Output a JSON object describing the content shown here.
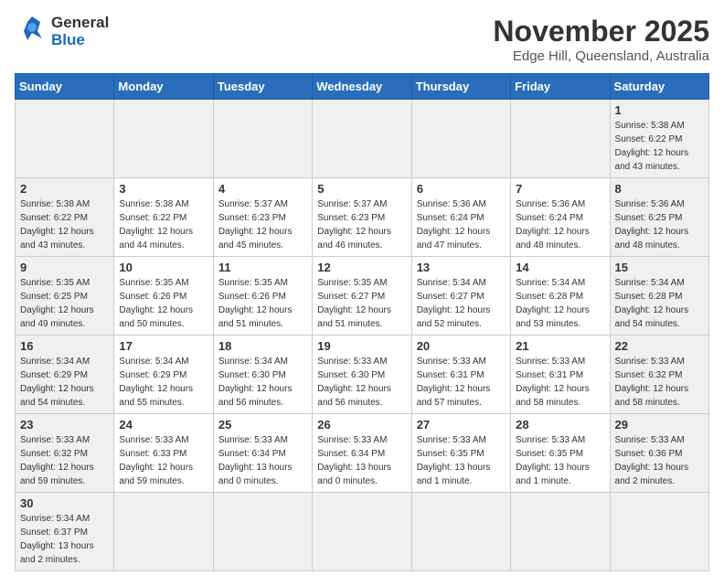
{
  "header": {
    "logo_general": "General",
    "logo_blue": "Blue",
    "month_title": "November 2025",
    "location": "Edge Hill, Queensland, Australia"
  },
  "weekdays": [
    "Sunday",
    "Monday",
    "Tuesday",
    "Wednesday",
    "Thursday",
    "Friday",
    "Saturday"
  ],
  "weeks": [
    [
      {
        "day": "",
        "info": "",
        "empty": true
      },
      {
        "day": "",
        "info": "",
        "empty": true
      },
      {
        "day": "",
        "info": "",
        "empty": true
      },
      {
        "day": "",
        "info": "",
        "empty": true
      },
      {
        "day": "",
        "info": "",
        "empty": true
      },
      {
        "day": "",
        "info": "",
        "empty": true
      },
      {
        "day": "1",
        "info": "Sunrise: 5:38 AM\nSunset: 6:22 PM\nDaylight: 12 hours\nand 43 minutes."
      }
    ],
    [
      {
        "day": "2",
        "info": "Sunrise: 5:38 AM\nSunset: 6:22 PM\nDaylight: 12 hours\nand 43 minutes."
      },
      {
        "day": "3",
        "info": "Sunrise: 5:38 AM\nSunset: 6:22 PM\nDaylight: 12 hours\nand 44 minutes."
      },
      {
        "day": "4",
        "info": "Sunrise: 5:37 AM\nSunset: 6:23 PM\nDaylight: 12 hours\nand 45 minutes."
      },
      {
        "day": "5",
        "info": "Sunrise: 5:37 AM\nSunset: 6:23 PM\nDaylight: 12 hours\nand 46 minutes."
      },
      {
        "day": "6",
        "info": "Sunrise: 5:36 AM\nSunset: 6:24 PM\nDaylight: 12 hours\nand 47 minutes."
      },
      {
        "day": "7",
        "info": "Sunrise: 5:36 AM\nSunset: 6:24 PM\nDaylight: 12 hours\nand 48 minutes."
      },
      {
        "day": "8",
        "info": "Sunrise: 5:36 AM\nSunset: 6:25 PM\nDaylight: 12 hours\nand 48 minutes."
      }
    ],
    [
      {
        "day": "9",
        "info": "Sunrise: 5:35 AM\nSunset: 6:25 PM\nDaylight: 12 hours\nand 49 minutes."
      },
      {
        "day": "10",
        "info": "Sunrise: 5:35 AM\nSunset: 6:26 PM\nDaylight: 12 hours\nand 50 minutes."
      },
      {
        "day": "11",
        "info": "Sunrise: 5:35 AM\nSunset: 6:26 PM\nDaylight: 12 hours\nand 51 minutes."
      },
      {
        "day": "12",
        "info": "Sunrise: 5:35 AM\nSunset: 6:27 PM\nDaylight: 12 hours\nand 51 minutes."
      },
      {
        "day": "13",
        "info": "Sunrise: 5:34 AM\nSunset: 6:27 PM\nDaylight: 12 hours\nand 52 minutes."
      },
      {
        "day": "14",
        "info": "Sunrise: 5:34 AM\nSunset: 6:28 PM\nDaylight: 12 hours\nand 53 minutes."
      },
      {
        "day": "15",
        "info": "Sunrise: 5:34 AM\nSunset: 6:28 PM\nDaylight: 12 hours\nand 54 minutes."
      }
    ],
    [
      {
        "day": "16",
        "info": "Sunrise: 5:34 AM\nSunset: 6:29 PM\nDaylight: 12 hours\nand 54 minutes."
      },
      {
        "day": "17",
        "info": "Sunrise: 5:34 AM\nSunset: 6:29 PM\nDaylight: 12 hours\nand 55 minutes."
      },
      {
        "day": "18",
        "info": "Sunrise: 5:34 AM\nSunset: 6:30 PM\nDaylight: 12 hours\nand 56 minutes."
      },
      {
        "day": "19",
        "info": "Sunrise: 5:33 AM\nSunset: 6:30 PM\nDaylight: 12 hours\nand 56 minutes."
      },
      {
        "day": "20",
        "info": "Sunrise: 5:33 AM\nSunset: 6:31 PM\nDaylight: 12 hours\nand 57 minutes."
      },
      {
        "day": "21",
        "info": "Sunrise: 5:33 AM\nSunset: 6:31 PM\nDaylight: 12 hours\nand 58 minutes."
      },
      {
        "day": "22",
        "info": "Sunrise: 5:33 AM\nSunset: 6:32 PM\nDaylight: 12 hours\nand 58 minutes."
      }
    ],
    [
      {
        "day": "23",
        "info": "Sunrise: 5:33 AM\nSunset: 6:32 PM\nDaylight: 12 hours\nand 59 minutes."
      },
      {
        "day": "24",
        "info": "Sunrise: 5:33 AM\nSunset: 6:33 PM\nDaylight: 12 hours\nand 59 minutes."
      },
      {
        "day": "25",
        "info": "Sunrise: 5:33 AM\nSunset: 6:34 PM\nDaylight: 13 hours\nand 0 minutes."
      },
      {
        "day": "26",
        "info": "Sunrise: 5:33 AM\nSunset: 6:34 PM\nDaylight: 13 hours\nand 0 minutes."
      },
      {
        "day": "27",
        "info": "Sunrise: 5:33 AM\nSunset: 6:35 PM\nDaylight: 13 hours\nand 1 minute."
      },
      {
        "day": "28",
        "info": "Sunrise: 5:33 AM\nSunset: 6:35 PM\nDaylight: 13 hours\nand 1 minute."
      },
      {
        "day": "29",
        "info": "Sunrise: 5:33 AM\nSunset: 6:36 PM\nDaylight: 13 hours\nand 2 minutes."
      }
    ],
    [
      {
        "day": "30",
        "info": "Sunrise: 5:34 AM\nSunset: 6:37 PM\nDaylight: 13 hours\nand 2 minutes."
      },
      {
        "day": "",
        "info": "",
        "empty": true
      },
      {
        "day": "",
        "info": "",
        "empty": true
      },
      {
        "day": "",
        "info": "",
        "empty": true
      },
      {
        "day": "",
        "info": "",
        "empty": true
      },
      {
        "day": "",
        "info": "",
        "empty": true
      },
      {
        "day": "",
        "info": "",
        "empty": true
      }
    ]
  ]
}
